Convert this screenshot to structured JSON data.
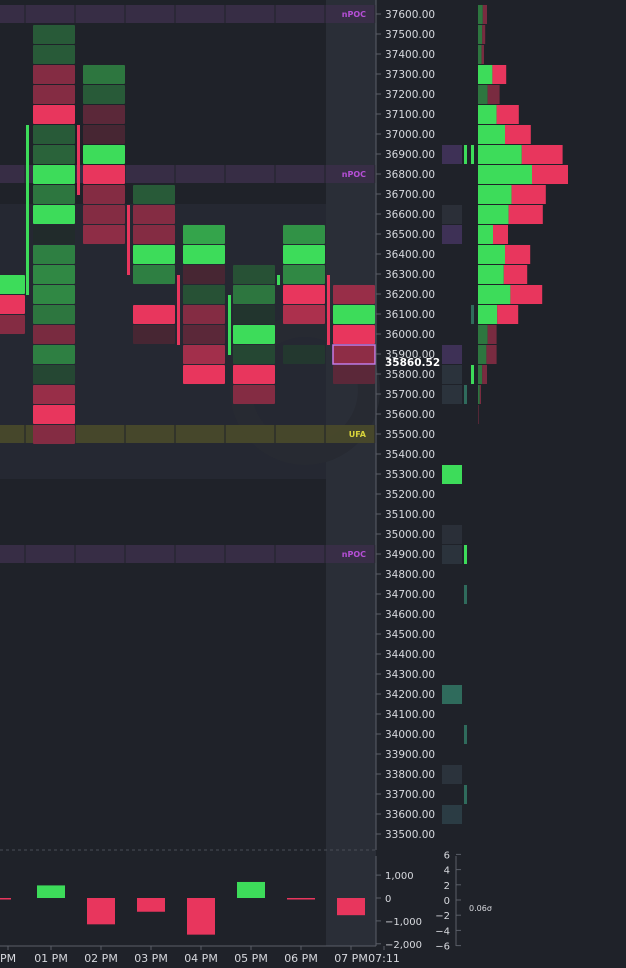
{
  "chart_data": {
    "type": "footprint",
    "instrument_price_axis": {
      "ticks": [
        "37600.00",
        "37500.00",
        "37400.00",
        "37300.00",
        "37200.00",
        "37100.00",
        "37000.00",
        "36900.00",
        "36800.00",
        "36700.00",
        "36600.00",
        "36500.00",
        "36400.00",
        "36300.00",
        "36200.00",
        "36100.00",
        "36000.00",
        "35900.00",
        "35800.00",
        "35700.00",
        "35600.00",
        "35500.00",
        "35400.00",
        "35300.00",
        "35200.00",
        "35100.00",
        "35000.00",
        "34900.00",
        "34800.00",
        "34700.00",
        "34600.00",
        "34500.00",
        "34400.00",
        "34300.00",
        "34200.00",
        "34100.00",
        "34000.00",
        "33900.00",
        "33800.00",
        "33700.00",
        "33600.00",
        "33500.00"
      ],
      "range": [
        33450,
        37650
      ]
    },
    "last_price_label": "35860.52",
    "last_price": 35860.52,
    "level_tags": [
      {
        "label": "nPOC",
        "price": 37600
      },
      {
        "label": "nPOC",
        "price": 36800
      },
      {
        "label": "UFA",
        "price": 35500
      },
      {
        "label": "nPOC",
        "price": 34900
      }
    ],
    "time_labels": [
      "PM",
      "01 PM",
      "02 PM",
      "03 PM",
      "04 PM",
      "05 PM",
      "06 PM",
      "07 PM",
      "07:11"
    ],
    "delta_axis": {
      "ticks": [
        "1,000",
        "0",
        "−1,000",
        "−2,000"
      ],
      "range": [
        -2000,
        1500
      ]
    },
    "delta_values": [
      -60,
      550,
      -1150,
      -600,
      -1600,
      700,
      -30,
      -750
    ],
    "sigma_axis": {
      "ticks": [
        "6",
        "4",
        "2",
        "0",
        "−2",
        "−4",
        "−6"
      ],
      "range": [
        -6,
        6
      ]
    },
    "sigma_label": "0.06σ",
    "volume_profile": [
      {
        "price": 37600,
        "buy": 8,
        "sell": 7
      },
      {
        "price": 37500,
        "buy": 7,
        "sell": 5
      },
      {
        "price": 37400,
        "buy": 6,
        "sell": 4
      },
      {
        "price": 37300,
        "buy": 24,
        "sell": 23
      },
      {
        "price": 37200,
        "buy": 16,
        "sell": 20
      },
      {
        "price": 37100,
        "buy": 31,
        "sell": 37
      },
      {
        "price": 37000,
        "buy": 45,
        "sell": 43
      },
      {
        "price": 36900,
        "buy": 73,
        "sell": 68
      },
      {
        "price": 36800,
        "buy": 90,
        "sell": 60
      },
      {
        "price": 36700,
        "buy": 56,
        "sell": 57
      },
      {
        "price": 36600,
        "buy": 51,
        "sell": 57
      },
      {
        "price": 36500,
        "buy": 25,
        "sell": 25
      },
      {
        "price": 36400,
        "buy": 45,
        "sell": 42
      },
      {
        "price": 36300,
        "buy": 43,
        "sell": 39
      },
      {
        "price": 36200,
        "buy": 54,
        "sell": 53
      },
      {
        "price": 36100,
        "buy": 32,
        "sell": 35
      },
      {
        "price": 36000,
        "buy": 16,
        "sell": 15
      },
      {
        "price": 35900,
        "buy": 14,
        "sell": 17
      },
      {
        "price": 35800,
        "buy": 7,
        "sell": 8
      },
      {
        "price": 35700,
        "buy": 3,
        "sell": 2
      },
      {
        "price": 35600,
        "buy": 0,
        "sell": 1
      }
    ],
    "colors": {
      "background": "#1f2229",
      "buy": "#3ddc5a",
      "sell": "#e8365d",
      "buy_dim": "#2f6b3e",
      "sell_dim": "#7a3444",
      "npoc": "#b64fd6",
      "ufa": "#d8d43a",
      "axis_text": "#d7d9de"
    }
  }
}
